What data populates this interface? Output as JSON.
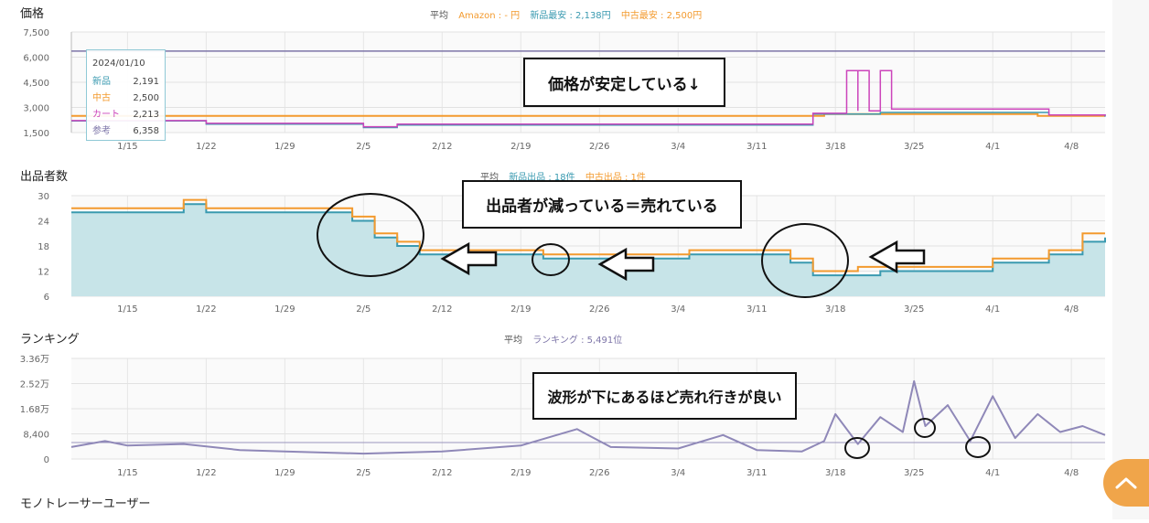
{
  "price_section": {
    "title": "価格",
    "avg_label": "平均",
    "amazon_label": "Amazon : - 円",
    "new_min_label": "新品最安 : 2,138円",
    "used_min_label": "中古最安 : 2,500円"
  },
  "seller_section": {
    "title": "出品者数",
    "avg_label": "平均",
    "new_label": "新品出品 : 18件",
    "used_label": "中古出品 : 1件"
  },
  "ranking_section": {
    "title": "ランキング",
    "avg_label": "平均",
    "ranking_label": "ランキング : 5,491位"
  },
  "footer_section": {
    "title": "モノトレーサーユーザー"
  },
  "tooltip": {
    "date": "2024/01/10",
    "rows": [
      {
        "label": "新品",
        "value": "2,191"
      },
      {
        "label": "中古",
        "value": "2,500"
      },
      {
        "label": "カート",
        "value": "2,213"
      },
      {
        "label": "参考",
        "value": "6,358"
      }
    ]
  },
  "annotations": {
    "price_stable": "価格が安定している↓",
    "sellers_decreasing": "出品者が減っている＝売れている",
    "wave_note": "波形が下にあるほど売れ行きが良い"
  },
  "colors": {
    "new": "#3a9ab0",
    "used": "#f39a2e",
    "cart": "#cc44bb",
    "reference": "#7d75a8",
    "ranking": "#8f88b8",
    "seller_fill": "#c7e4e8",
    "accent_button": "#f0a54a"
  },
  "chart_data": [
    {
      "type": "line",
      "title": "価格",
      "x_tick_labels": [
        "1/15",
        "1/22",
        "1/29",
        "2/5",
        "2/12",
        "2/19",
        "2/26",
        "3/4",
        "3/11",
        "3/18",
        "3/25",
        "4/1",
        "4/8"
      ],
      "y_tick_labels": [
        "7,500",
        "6,000",
        "4,500",
        "3,000",
        "1,500"
      ],
      "ylim": [
        1500,
        7500
      ],
      "series": [
        {
          "name": "参考",
          "points": [
            [
              "2024-01-10",
              6358
            ],
            [
              "2024-04-11",
              6358
            ]
          ]
        },
        {
          "name": "中古",
          "points": [
            [
              "2024-01-10",
              2500
            ],
            [
              "2024-03-16",
              2500
            ],
            [
              "2024-03-17",
              2600
            ],
            [
              "2024-04-05",
              2500
            ],
            [
              "2024-04-11",
              2500
            ]
          ]
        },
        {
          "name": "新品",
          "points": [
            [
              "2024-01-10",
              2191
            ],
            [
              "2024-01-22",
              2000
            ],
            [
              "2024-02-05",
              1800
            ],
            [
              "2024-02-08",
              1950
            ],
            [
              "2024-03-15",
              1950
            ],
            [
              "2024-03-16",
              2600
            ],
            [
              "2024-03-22",
              2700
            ],
            [
              "2024-04-06",
              2550
            ],
            [
              "2024-04-11",
              2450
            ]
          ]
        },
        {
          "name": "カート",
          "points": [
            [
              "2024-01-10",
              2213
            ],
            [
              "2024-01-22",
              2050
            ],
            [
              "2024-02-05",
              1850
            ],
            [
              "2024-02-08",
              2000
            ],
            [
              "2024-03-15",
              2000
            ],
            [
              "2024-03-16",
              2650
            ],
            [
              "2024-03-19",
              2650
            ],
            [
              "2024-03-19",
              5200
            ],
            [
              "2024-03-20",
              2800
            ],
            [
              "2024-03-20",
              5200
            ],
            [
              "2024-03-21",
              2800
            ],
            [
              "2024-03-22",
              5200
            ],
            [
              "2024-03-23",
              2900
            ],
            [
              "2024-04-05",
              2900
            ],
            [
              "2024-04-06",
              2550
            ],
            [
              "2024-04-11",
              2500
            ]
          ]
        }
      ]
    },
    {
      "type": "area",
      "title": "出品者数",
      "x_tick_labels": [
        "1/15",
        "1/22",
        "1/29",
        "2/5",
        "2/12",
        "2/19",
        "2/26",
        "3/4",
        "3/11",
        "3/18",
        "3/25",
        "4/1",
        "4/8"
      ],
      "y_tick_labels": [
        "30",
        "24",
        "18",
        "12",
        "6"
      ],
      "ylim": [
        6,
        30
      ],
      "series": [
        {
          "name": "新品出品",
          "points": [
            [
              "2024-01-10",
              26
            ],
            [
              "2024-01-20",
              28
            ],
            [
              "2024-01-22",
              26
            ],
            [
              "2024-02-01",
              26
            ],
            [
              "2024-02-04",
              24
            ],
            [
              "2024-02-06",
              20
            ],
            [
              "2024-02-08",
              18
            ],
            [
              "2024-02-10",
              16
            ],
            [
              "2024-02-18",
              16
            ],
            [
              "2024-02-21",
              15
            ],
            [
              "2024-02-27",
              15
            ],
            [
              "2024-03-05",
              16
            ],
            [
              "2024-03-12",
              16
            ],
            [
              "2024-03-14",
              14
            ],
            [
              "2024-03-16",
              11
            ],
            [
              "2024-03-20",
              11
            ],
            [
              "2024-03-22",
              12
            ],
            [
              "2024-03-28",
              12
            ],
            [
              "2024-04-01",
              14
            ],
            [
              "2024-04-06",
              16
            ],
            [
              "2024-04-09",
              19
            ],
            [
              "2024-04-11",
              20
            ]
          ]
        },
        {
          "name": "中古出品",
          "points": [
            [
              "2024-01-10",
              27
            ],
            [
              "2024-01-20",
              29
            ],
            [
              "2024-01-22",
              27
            ],
            [
              "2024-02-01",
              27
            ],
            [
              "2024-02-04",
              25
            ],
            [
              "2024-02-06",
              21
            ],
            [
              "2024-02-08",
              19
            ],
            [
              "2024-02-10",
              17
            ],
            [
              "2024-02-18",
              17
            ],
            [
              "2024-02-21",
              16
            ],
            [
              "2024-02-27",
              16
            ],
            [
              "2024-03-05",
              17
            ],
            [
              "2024-03-12",
              17
            ],
            [
              "2024-03-14",
              15
            ],
            [
              "2024-03-16",
              12
            ],
            [
              "2024-03-20",
              13
            ],
            [
              "2024-03-22",
              13
            ],
            [
              "2024-03-28",
              13
            ],
            [
              "2024-04-01",
              15
            ],
            [
              "2024-04-06",
              17
            ],
            [
              "2024-04-09",
              21
            ],
            [
              "2024-04-11",
              21
            ]
          ]
        }
      ]
    },
    {
      "type": "line",
      "title": "ランキング",
      "x_tick_labels": [
        "1/15",
        "1/22",
        "1/29",
        "2/5",
        "2/12",
        "2/19",
        "2/26",
        "3/4",
        "3/11",
        "3/18",
        "3/25",
        "4/1",
        "4/8"
      ],
      "y_tick_labels": [
        "3.36万",
        "2.52万",
        "1.68万",
        "8,400",
        "0"
      ],
      "ylim": [
        0,
        33600
      ],
      "series": [
        {
          "name": "ランキング",
          "points": [
            [
              "2024-01-10",
              4000
            ],
            [
              "2024-01-13",
              6000
            ],
            [
              "2024-01-15",
              4500
            ],
            [
              "2024-01-20",
              5000
            ],
            [
              "2024-01-25",
              3000
            ],
            [
              "2024-01-29",
              2500
            ],
            [
              "2024-02-05",
              1800
            ],
            [
              "2024-02-12",
              2500
            ],
            [
              "2024-02-19",
              4500
            ],
            [
              "2024-02-24",
              10000
            ],
            [
              "2024-02-27",
              4000
            ],
            [
              "2024-03-04",
              3500
            ],
            [
              "2024-03-08",
              8000
            ],
            [
              "2024-03-11",
              3000
            ],
            [
              "2024-03-15",
              2500
            ],
            [
              "2024-03-17",
              6000
            ],
            [
              "2024-03-18",
              15000
            ],
            [
              "2024-03-20",
              5000
            ],
            [
              "2024-03-22",
              14000
            ],
            [
              "2024-03-24",
              9000
            ],
            [
              "2024-03-25",
              26000
            ],
            [
              "2024-03-26",
              11000
            ],
            [
              "2024-03-28",
              18000
            ],
            [
              "2024-03-30",
              6000
            ],
            [
              "2024-04-01",
              21000
            ],
            [
              "2024-04-03",
              7000
            ],
            [
              "2024-04-05",
              15000
            ],
            [
              "2024-04-07",
              9000
            ],
            [
              "2024-04-09",
              11000
            ],
            [
              "2024-04-11",
              8000
            ]
          ]
        }
      ]
    }
  ]
}
